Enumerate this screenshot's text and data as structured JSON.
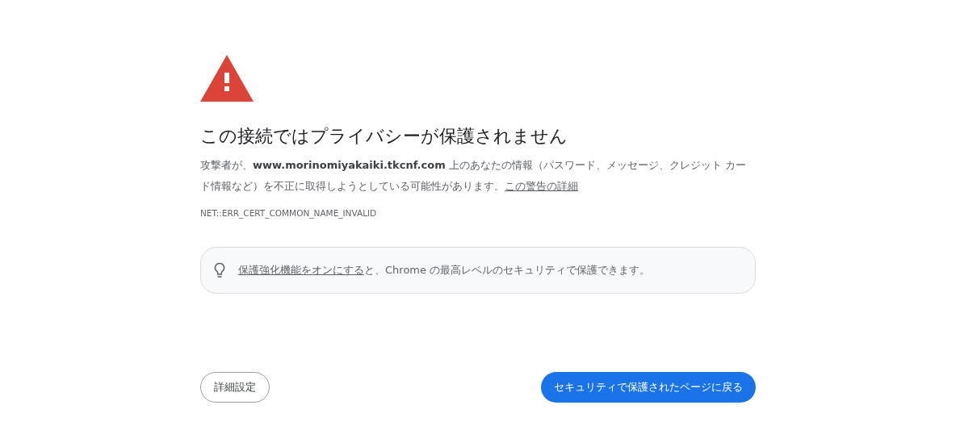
{
  "heading": "この接続ではプライバシーが保護されません",
  "description": {
    "text": "攻撃者が、**www.morinomiyakaiki.tkcnf.com** 上のあなたの情報（パスワード、メッセージ、クレジット カード情報など）を不正に取得しようとしている可能性があります。",
    "link": "この警告の詳細"
  },
  "error_code": "NET::ERR_CERT_COMMON_NAME_INVALID",
  "tip": {
    "link": "保護強化機能をオンにする",
    "text": "と、Chrome の最高レベルのセキュリティで保護できます。"
  },
  "buttons": [
    {
      "label": "詳細設定",
      "kind": "secondary"
    },
    {
      "label": "セキュリティで保護されたページに戻る",
      "kind": "primary"
    }
  ]
}
